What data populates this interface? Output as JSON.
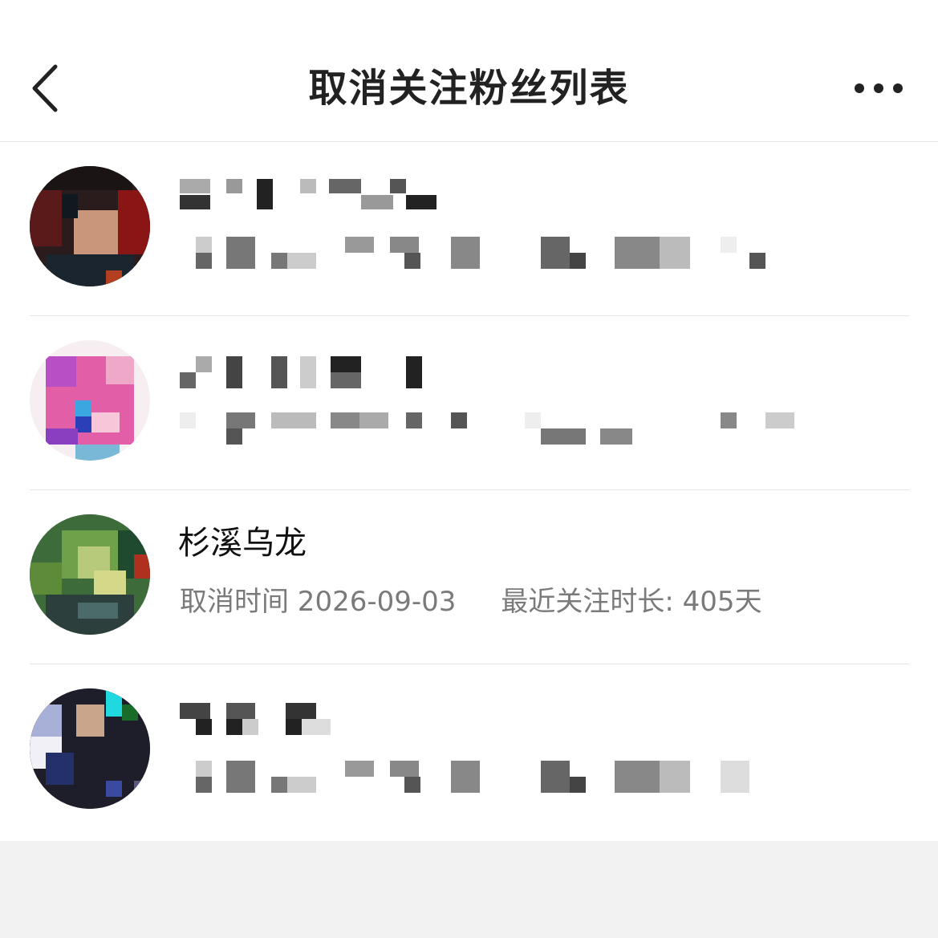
{
  "header": {
    "title": "取消关注粉丝列表",
    "back_icon": "chevron-left-icon",
    "more_icon": "more-horizontal-icon"
  },
  "list": [
    {
      "name": "",
      "meta_time_label": "",
      "meta_duration_label": "",
      "pixelated": true
    },
    {
      "name": "",
      "meta_time_label": "",
      "meta_duration_label": "",
      "pixelated": true
    },
    {
      "name": "杉溪乌龙",
      "meta_time_label": "取消时间 2026-09-03",
      "meta_duration_label": "最近关注时长: 405天",
      "pixelated": false
    },
    {
      "name": "",
      "meta_time_label": "",
      "meta_duration_label": "",
      "pixelated": true
    }
  ],
  "colors": {
    "background": "#ffffff",
    "footer_background": "#f2f2f2",
    "title_text": "#222222",
    "meta_text": "#7a7a7a",
    "divider": "#e5e5e5"
  }
}
